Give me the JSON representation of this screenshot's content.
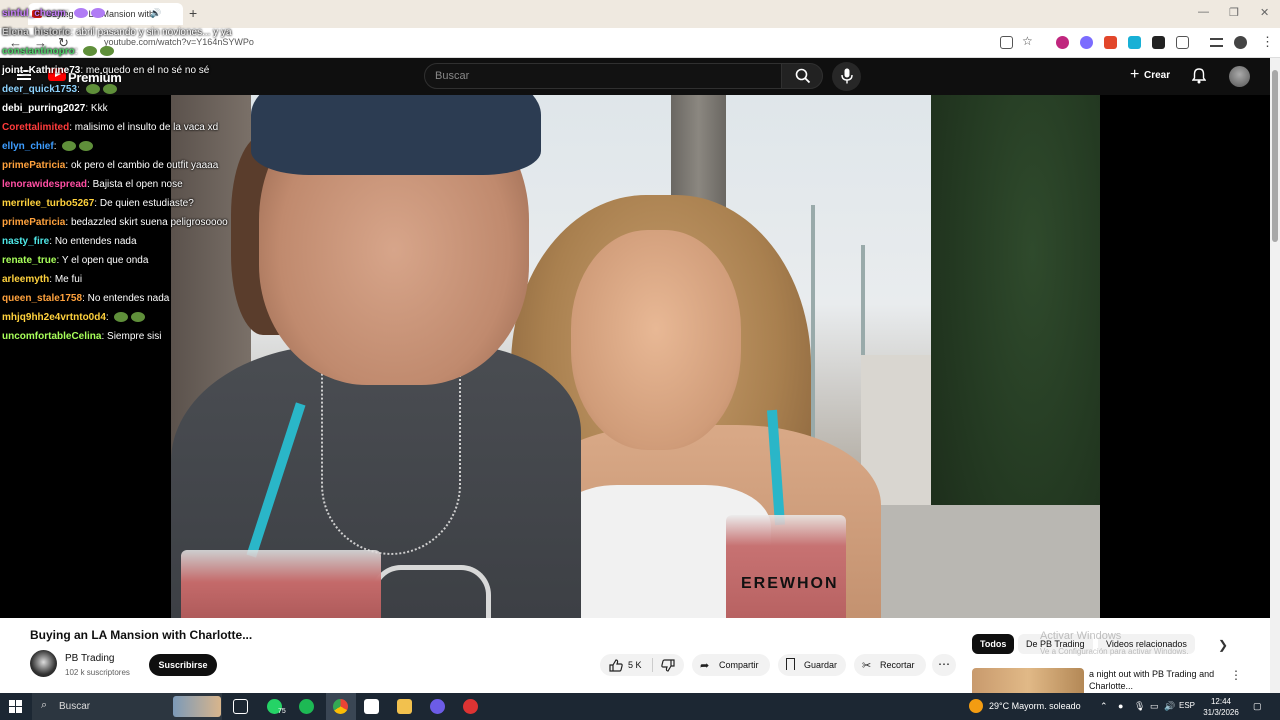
{
  "browser": {
    "tab_title": "Buying an LA Mansion with",
    "url": "youtube.com/watch?v=Y164nSYWPo",
    "new_tab": "+",
    "tab_close": "✕",
    "back": "←",
    "forward": "→",
    "reload": "↻"
  },
  "header": {
    "logo_text": "Premium",
    "search_placeholder": "Buscar",
    "create_label": "Crear"
  },
  "chat": [
    {
      "user": "sinful_cheam",
      "text": "",
      "color": "#c27cf5"
    },
    {
      "user": "Elena_historic",
      "text": "abril pasando y sin noviones... y ya",
      "color": "#c9c9c9"
    },
    {
      "user": "constantinopro",
      "text": "",
      "color": "#4fd26a"
    },
    {
      "user": "joint_Kathrine73",
      "text": "me quedo en el no sé no sé",
      "color": "#ffffff"
    },
    {
      "user": "deer_quick1753",
      "text": "",
      "color": "#8fd4ff"
    },
    {
      "user": "debi_purring2027",
      "text": "Kkk",
      "color": "#ffffff"
    },
    {
      "user": "Corettalimited",
      "text": "malisimo el insulto de la vaca xd",
      "color": "#ff3b3b"
    },
    {
      "user": "ellyn_chief",
      "text": "",
      "color": "#3d9dff"
    },
    {
      "user": "primePatricia",
      "text": "ok pero el cambio de outfit yaaaa",
      "color": "#ffa23d"
    },
    {
      "user": "lenorawidespread",
      "text": "Bajista el open nose",
      "color": "#ff4fa3"
    },
    {
      "user": "merrilee_turbo5267",
      "text": "De quien estudiaste?",
      "color": "#ffd23d"
    },
    {
      "user": "primePatricia",
      "text": "bedazzled skirt suena peligrosoooo",
      "color": "#ffa23d"
    },
    {
      "user": "nasty_fire",
      "text": "No entendes nada",
      "color": "#4fe8e8"
    },
    {
      "user": "renate_true",
      "text": "Y el open que onda",
      "color": "#a8ff5a"
    },
    {
      "user": "arleemyth",
      "text": "Me fui",
      "color": "#ffd23d"
    },
    {
      "user": "queen_stale1758",
      "text": "No entendes nada",
      "color": "#ffa23d"
    },
    {
      "user": "mhjq9hh2e4vrtnto0d4",
      "text": "",
      "color": "#ffd23d"
    },
    {
      "user": "uncomfortableCelina",
      "text": "Siempre sisi",
      "color": "#a8ff5a"
    }
  ],
  "video": {
    "cup_label": "EREWHON",
    "title": "Buying an LA Mansion with Charlotte...",
    "channel_name": "PB Trading",
    "subscribers": "102 k suscriptores",
    "subscribe_label": "Suscribirse",
    "likes": "5 K",
    "share_label": "Compartir",
    "save_label": "Guardar",
    "clip_label": "Recortar",
    "more_label": "⋯"
  },
  "recommendations": {
    "chips": [
      "Todos",
      "De PB Trading",
      "Videos relacionados"
    ],
    "activate_line1": "Activar Windows",
    "activate_line2": "Ve a Configuración para activar Windows.",
    "item_title": "a night out with PB Trading and Charlotte..."
  },
  "taskbar": {
    "search_label": "Buscar",
    "whatsapp_badge": "75",
    "weather": "29°C  Mayorm. soleado",
    "lang": "ESP",
    "time": "12:44",
    "date": "31/3/2026"
  },
  "colors": {
    "youtube_red": "#ff0000",
    "dark_bg": "#0f0f0f",
    "taskbar": "#1c2733"
  }
}
